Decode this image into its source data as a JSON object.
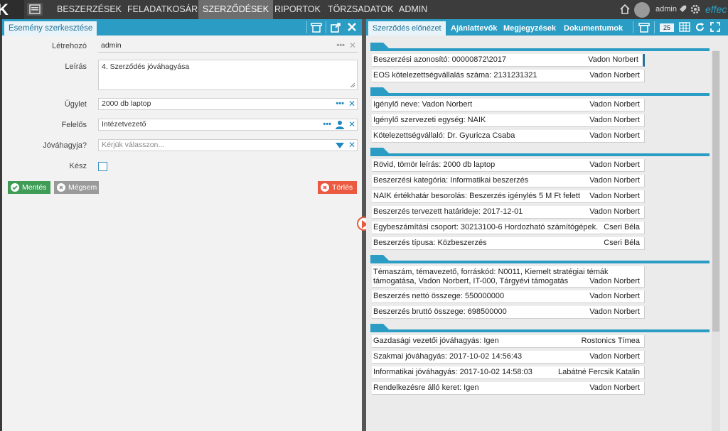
{
  "nav": {
    "items": [
      "BESZERZÉSEK",
      "FELADATKOSÁR",
      "SZERZŐDÉSEK",
      "RIPORTOK",
      "TÖRZSADATOK",
      "ADMIN"
    ],
    "active": "SZERZŐDÉSEK",
    "user": "admin",
    "brand": "effec"
  },
  "left": {
    "title": "Esemény szerkesztése",
    "fields": {
      "creator_label": "Létrehozó",
      "creator_value": "admin",
      "description_label": "Leírás",
      "description_value": "4. Szerződés jóváhagyása",
      "case_label": "Ügylet",
      "case_value": "2000 db laptop",
      "owner_label": "Felelős",
      "owner_value": "Intézetvezető",
      "approve_label": "Jóváhagyja?",
      "approve_placeholder": "Kérjük válasszon...",
      "done_label": "Kész"
    },
    "buttons": {
      "save": "Mentés",
      "cancel": "Mégsem",
      "delete": "Törlés"
    }
  },
  "right": {
    "tabs": [
      "Szerződés előnézet",
      "Ajánlattevők",
      "Megjegyzések",
      "Dokumentumok"
    ],
    "page_size": "25",
    "sections": [
      {
        "rows": [
          {
            "text": "Beszerzési azonosító: 00000872\\2017",
            "who": "Vadon Norbert"
          },
          {
            "text": "EOS kötelezettségvállalás száma: 2131231321",
            "who": "Vadon Norbert"
          }
        ]
      },
      {
        "rows": [
          {
            "text": "Igénylő neve: Vadon Norbert",
            "who": "Vadon Norbert"
          },
          {
            "text": "Igénylő szervezeti egység: NAIK",
            "who": "Vadon Norbert"
          },
          {
            "text": "Kötelezettségvállaló: Dr. Gyuricza Csaba",
            "who": "Vadon Norbert"
          }
        ]
      },
      {
        "rows": [
          {
            "text": "Rövid, tömör leírás: 2000 db laptop",
            "who": "Vadon Norbert"
          },
          {
            "text": "Beszerzési kategória: Informatikai beszerzés",
            "who": "Vadon Norbert"
          },
          {
            "text": "NAIK értékhatár besorolás: Beszerzés igénylés 5 M Ft felett",
            "who": "Vadon Norbert"
          },
          {
            "text": "Beszerzés tervezett határideje: 2017-12-01",
            "who": "Vadon Norbert"
          },
          {
            "text": "Egybeszámítási csoport: 30213100-6 Hordozható számítógépek.",
            "who": "Cseri Béla"
          },
          {
            "text": "Beszerzés típusa: Közbeszerzés",
            "who": "Cseri Béla"
          }
        ]
      },
      {
        "rows": [
          {
            "text": "Témaszám, témavezető, forráskód: N0011, Kiemelt stratégiai témák támogatása, Vadon Norbert, IT-000, Tárgyévi támogatás",
            "who": "Vadon Norbert",
            "tall": true
          },
          {
            "text": "Beszerzés nettó összege: 550000000",
            "who": "Vadon Norbert"
          },
          {
            "text": "Beszerzés bruttó összege: 698500000",
            "who": "Vadon Norbert"
          }
        ]
      },
      {
        "rows": [
          {
            "text": "Gazdasági vezetői jóváhagyás: Igen",
            "who": "Rostonics Tímea"
          },
          {
            "text": "Szakmai jóváhagyás: 2017-10-02 14:56:43",
            "who": "Vadon Norbert"
          },
          {
            "text": "Informatikai jóváhagyás: 2017-10-02 14:58:03",
            "who": "Labátné Fercsik Katalin"
          },
          {
            "text": "Rendelkezésre álló keret: Igen",
            "who": "Vadon Norbert"
          }
        ]
      }
    ]
  }
}
